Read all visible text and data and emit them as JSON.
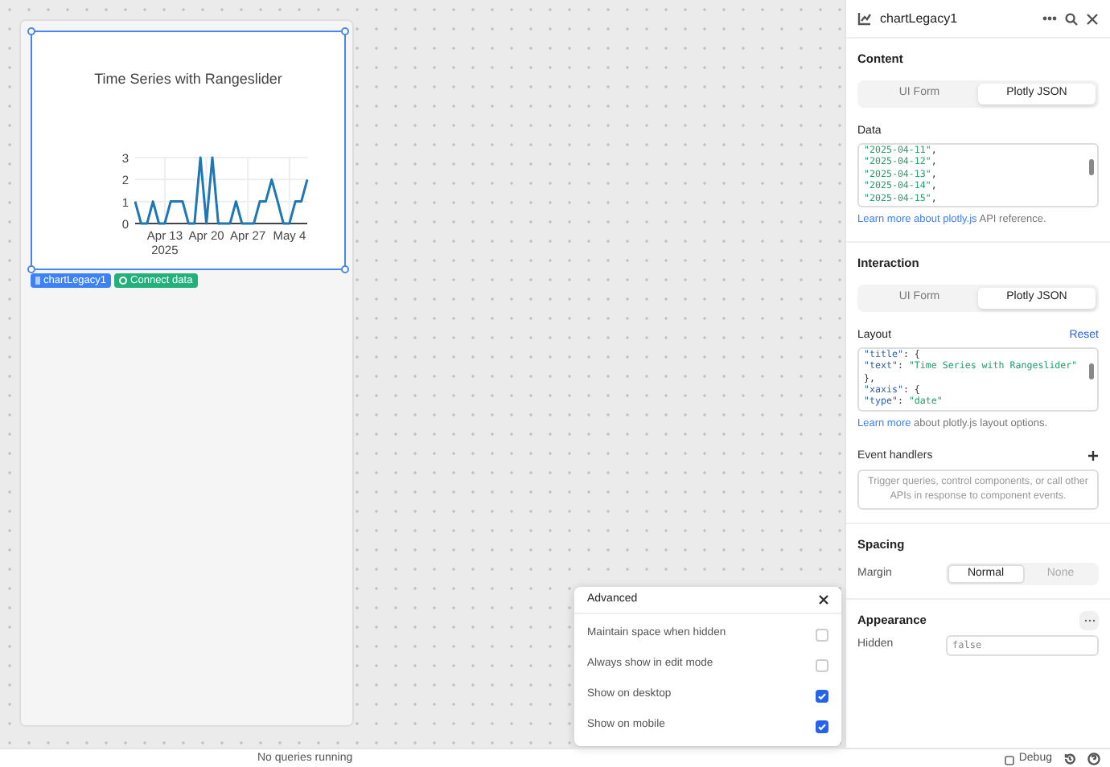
{
  "canvas": {
    "component": {
      "name_tag": "chartLegacy1",
      "connect_label": "Connect data",
      "chart_data": {
        "type": "line",
        "title": "Time Series with Rangeslider",
        "x": [
          "2025-04-08",
          "2025-04-09",
          "2025-04-10",
          "2025-04-11",
          "2025-04-12",
          "2025-04-13",
          "2025-04-14",
          "2025-04-15",
          "2025-04-16",
          "2025-04-17",
          "2025-04-18",
          "2025-04-19",
          "2025-04-20",
          "2025-04-21",
          "2025-04-22",
          "2025-04-23",
          "2025-04-24",
          "2025-04-25",
          "2025-04-26",
          "2025-04-27",
          "2025-04-28",
          "2025-04-29",
          "2025-04-30",
          "2025-05-01",
          "2025-05-02",
          "2025-05-03",
          "2025-05-04",
          "2025-05-05",
          "2025-05-06",
          "2025-05-07"
        ],
        "xlim": [
          "2025-04-08",
          "2025-05-07"
        ],
        "grid": true,
        "series": [
          {
            "color": "#1f77b4",
            "values": [
              1,
              0,
              0,
              1,
              0,
              0,
              1,
              1,
              1,
              0,
              0,
              3,
              0,
              3,
              0,
              0,
              0,
              1,
              0,
              0,
              0,
              1,
              1,
              2,
              1,
              0,
              0,
              1,
              1,
              2
            ]
          }
        ],
        "xticks": [
          {
            "value": "2025-04-13",
            "label": "Apr 13\n2025"
          },
          {
            "value": "2025-04-20",
            "label": "Apr 20"
          },
          {
            "value": "2025-04-27",
            "label": "Apr 27"
          },
          {
            "value": "2025-05-04",
            "label": "May 4"
          }
        ],
        "yticks": [
          0,
          1,
          2,
          3
        ],
        "ylim": [
          0,
          3
        ]
      }
    }
  },
  "inspector": {
    "title": "chartLegacy1",
    "sections": [
      {
        "kind": "code",
        "heading": "Content",
        "tabs": [
          {
            "label": "UI Form",
            "selected": false
          },
          {
            "label": "Plotly JSON",
            "selected": true
          }
        ],
        "field_label": "Data",
        "code_lines": [
          [
            {
              "t": "\"2025-04-11\"",
              "color": "#22a06b"
            },
            {
              "t": ","
            }
          ],
          [
            {
              "t": "\"2025-04-12\"",
              "color": "#22a06b"
            },
            {
              "t": ","
            }
          ],
          [
            {
              "t": "\"2025-04-13\"",
              "color": "#22a06b"
            },
            {
              "t": ","
            }
          ],
          [
            {
              "t": "\"2025-04-14\"",
              "color": "#22a06b"
            },
            {
              "t": ","
            }
          ],
          [
            {
              "t": "\"2025-04-15\"",
              "color": "#22a06b"
            },
            {
              "t": ","
            }
          ]
        ],
        "link": "Learn more about plotly.js",
        "after_link": " API reference."
      },
      {
        "kind": "code",
        "heading": "Interaction",
        "tabs": [
          {
            "label": "UI Form",
            "selected": false
          },
          {
            "label": "Plotly JSON",
            "selected": true
          }
        ],
        "field_label": "Layout",
        "reset": "Reset",
        "code_lines": [
          [
            {
              "t": "\"title\"",
              "color": "#2d5fa8"
            },
            {
              "t": ": {"
            }
          ],
          [
            {
              "t": "\"text\"",
              "color": "#2d5fa8"
            },
            {
              "t": ": "
            },
            {
              "t": "\"Time Series with Rangeslider\"",
              "color": "#22a06b"
            }
          ],
          [
            {
              "t": "},"
            }
          ],
          [
            {
              "t": "\"xaxis\"",
              "color": "#2d5fa8"
            },
            {
              "t": ": {"
            }
          ],
          [
            {
              "t": "\"type\"",
              "color": "#2d5fa8"
            },
            {
              "t": ": "
            },
            {
              "t": "\"date\"",
              "color": "#22a06b"
            }
          ]
        ],
        "link": "Learn more",
        "after_link": " about plotly.js layout options.",
        "events_label": "Event handlers",
        "events_hint": "Trigger queries, control components, or call other APIs in response to component events."
      },
      {
        "kind": "spacing",
        "heading": "Spacing",
        "label": "Margin",
        "options": [
          {
            "label": "Normal",
            "selected": true
          },
          {
            "label": "None",
            "selected": false
          }
        ]
      },
      {
        "kind": "appearance",
        "heading": "Appearance",
        "label": "Hidden",
        "value": "false"
      }
    ]
  },
  "advanced_popup": {
    "title": "Advanced",
    "options": [
      {
        "label": "Maintain space when hidden",
        "checked": false
      },
      {
        "label": "Always show in edit mode",
        "checked": false
      },
      {
        "label": "Show on desktop",
        "checked": true
      },
      {
        "label": "Show on mobile",
        "checked": true
      }
    ]
  },
  "status_bar": {
    "text": "No queries running",
    "debug": "Debug"
  }
}
